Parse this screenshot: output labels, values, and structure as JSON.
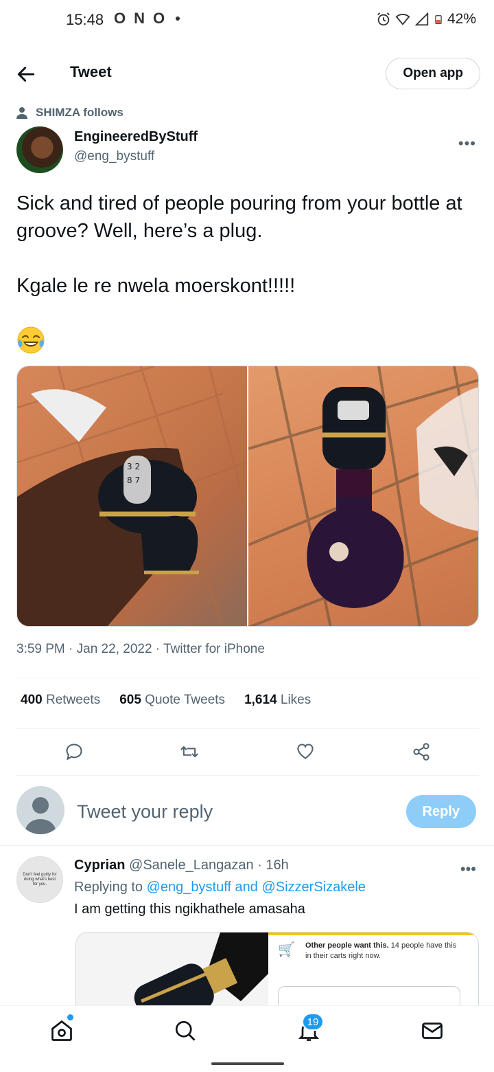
{
  "status_bar": {
    "time": "15:48",
    "notification_glyphs": [
      "O",
      "N",
      "O"
    ],
    "battery": "42%"
  },
  "header": {
    "title": "Tweet",
    "open_app": "Open app"
  },
  "social_context": "SHIMZA follows",
  "tweet": {
    "author_name": "EngineeredByStuff",
    "author_handle": "@eng_bystuff",
    "text_line1": "Sick and tired of people pouring from your bottle at groove? Well, here’s a plug.",
    "text_line2": "Kgale le re nwela moerskont!!!!!",
    "emoji": "😂",
    "meta": "3:59 PM · Jan 22, 2022 · Twitter for iPhone",
    "retweets_count": "400",
    "retweets_label": "Retweets",
    "quotes_count": "605",
    "quotes_label": "Quote Tweets",
    "likes_count": "1,614",
    "likes_label": "Likes"
  },
  "compose": {
    "placeholder": "Tweet your reply",
    "reply_button": "Reply"
  },
  "reply": {
    "avatar_text": "Don't feel guilty for doing what's best for you.",
    "name": "Cyprian",
    "handle": "@Sanele_Langazan",
    "time": "· 16h",
    "replying_prefix": "Replying to",
    "replying_to": "@eng_bystuff and @SizzerSizakele",
    "text": "I am getting this ngikhathele amasaha",
    "shop_title": "Other people want this.",
    "shop_text": "14 people have this in their carts right now."
  },
  "bottom_nav": {
    "notifications_count": "19"
  },
  "colors": {
    "accent": "#1d9bf0",
    "reply_button_bg": "#8ecdf8",
    "secondary_text": "#536471"
  }
}
